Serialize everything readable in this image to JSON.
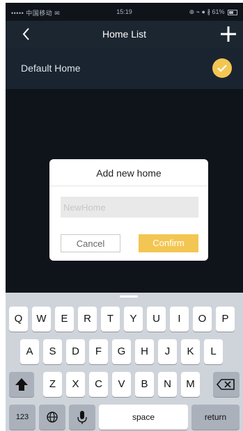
{
  "status_bar": {
    "carrier": "••••• 中国移动 ✉",
    "time": "15:19",
    "right": "⊕ ⌁ ● ∦ 61%"
  },
  "nav": {
    "title": "Home List",
    "back_icon": "chevron-left-icon",
    "add_icon": "plus-icon"
  },
  "home_list": [
    {
      "label": "Default Home",
      "selected": true
    }
  ],
  "dialog": {
    "title": "Add new home",
    "input_placeholder": "NewHome",
    "input_value": "",
    "cancel_label": "Cancel",
    "confirm_label": "Confirm"
  },
  "keyboard": {
    "row1": [
      "Q",
      "W",
      "E",
      "R",
      "T",
      "Y",
      "U",
      "I",
      "O",
      "P"
    ],
    "row2": [
      "A",
      "S",
      "D",
      "F",
      "G",
      "H",
      "J",
      "K",
      "L"
    ],
    "row3": [
      "Z",
      "X",
      "C",
      "V",
      "B",
      "N",
      "M"
    ],
    "numbers_label": "123",
    "space_label": "space",
    "return_label": "return"
  },
  "colors": {
    "accent": "#f3c653",
    "background": "#0f141b",
    "nav_bar": "#1c2631"
  }
}
